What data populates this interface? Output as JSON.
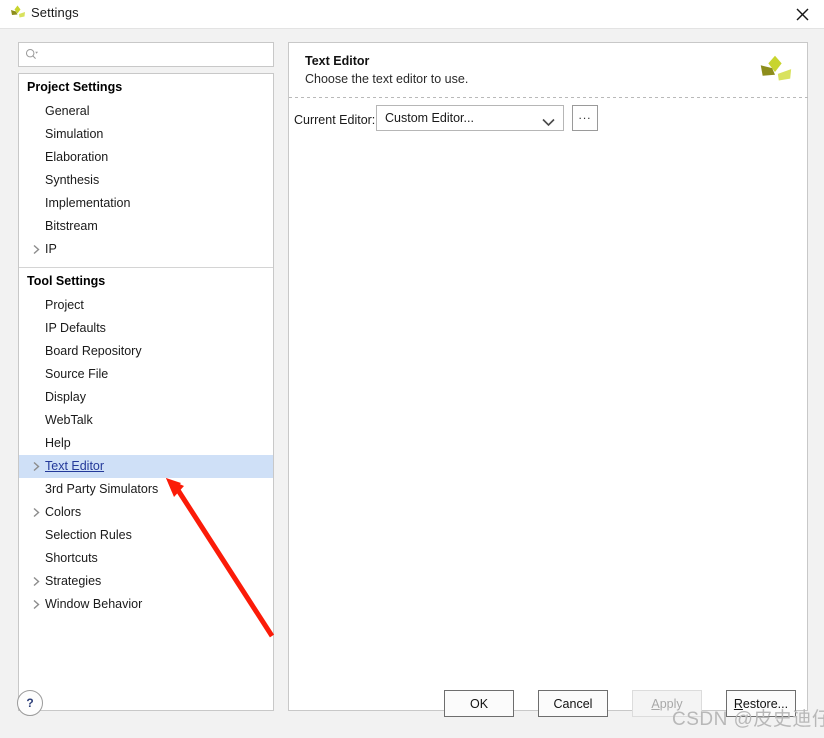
{
  "window": {
    "title": "Settings",
    "logo_icon": "vivado-logo-icon",
    "close_icon": "close-icon"
  },
  "search": {
    "placeholder": "",
    "value": "",
    "icon": "search-icon"
  },
  "sidebar": {
    "groups": [
      {
        "title": "Project Settings",
        "items": [
          {
            "label": "General",
            "expandable": false,
            "selected": false
          },
          {
            "label": "Simulation",
            "expandable": false,
            "selected": false
          },
          {
            "label": "Elaboration",
            "expandable": false,
            "selected": false
          },
          {
            "label": "Synthesis",
            "expandable": false,
            "selected": false
          },
          {
            "label": "Implementation",
            "expandable": false,
            "selected": false
          },
          {
            "label": "Bitstream",
            "expandable": false,
            "selected": false
          },
          {
            "label": "IP",
            "expandable": true,
            "selected": false
          }
        ]
      },
      {
        "title": "Tool Settings",
        "items": [
          {
            "label": "Project",
            "expandable": false,
            "selected": false
          },
          {
            "label": "IP Defaults",
            "expandable": false,
            "selected": false
          },
          {
            "label": "Board Repository",
            "expandable": false,
            "selected": false
          },
          {
            "label": "Source File",
            "expandable": false,
            "selected": false
          },
          {
            "label": "Display",
            "expandable": false,
            "selected": false
          },
          {
            "label": "WebTalk",
            "expandable": false,
            "selected": false
          },
          {
            "label": "Help",
            "expandable": false,
            "selected": false
          },
          {
            "label": "Text Editor",
            "expandable": true,
            "selected": true
          },
          {
            "label": "3rd Party Simulators",
            "expandable": false,
            "selected": false
          },
          {
            "label": "Colors",
            "expandable": true,
            "selected": false
          },
          {
            "label": "Selection Rules",
            "expandable": false,
            "selected": false
          },
          {
            "label": "Shortcuts",
            "expandable": false,
            "selected": false
          },
          {
            "label": "Strategies",
            "expandable": true,
            "selected": false
          },
          {
            "label": "Window Behavior",
            "expandable": true,
            "selected": false
          }
        ]
      }
    ]
  },
  "panel": {
    "title": "Text Editor",
    "subtitle": "Choose the text editor to use.",
    "logo_icon": "vivado-logo-icon",
    "editor_row": {
      "label": "Current Editor:",
      "label_mnemonic": "E",
      "selected_value": "Custom Editor...",
      "caret_icon": "chevron-down-icon",
      "more_button_label": "...",
      "options": [
        "Custom Editor..."
      ]
    }
  },
  "footer": {
    "help_label": "?",
    "help_icon": "question-mark-icon",
    "buttons": [
      {
        "label": "OK",
        "disabled": false,
        "mnemonic": ""
      },
      {
        "label": "Cancel",
        "disabled": false,
        "mnemonic": ""
      },
      {
        "label": "Apply",
        "disabled": true,
        "mnemonic": "A"
      },
      {
        "label": "Restore...",
        "disabled": false,
        "mnemonic": "R"
      }
    ]
  },
  "annotation": {
    "arrow_color": "#fb1b08",
    "watermark": "CSDN @皮史迪仔"
  },
  "colors": {
    "selection_bg": "#cfe0f7",
    "selection_text": "#23399a",
    "dialog_bg": "#f2f2f2",
    "panel_bg": "#ffffff",
    "border": "#c8c8c8",
    "logo_green": "#c3d02a",
    "logo_olive": "#8a8a1e"
  }
}
